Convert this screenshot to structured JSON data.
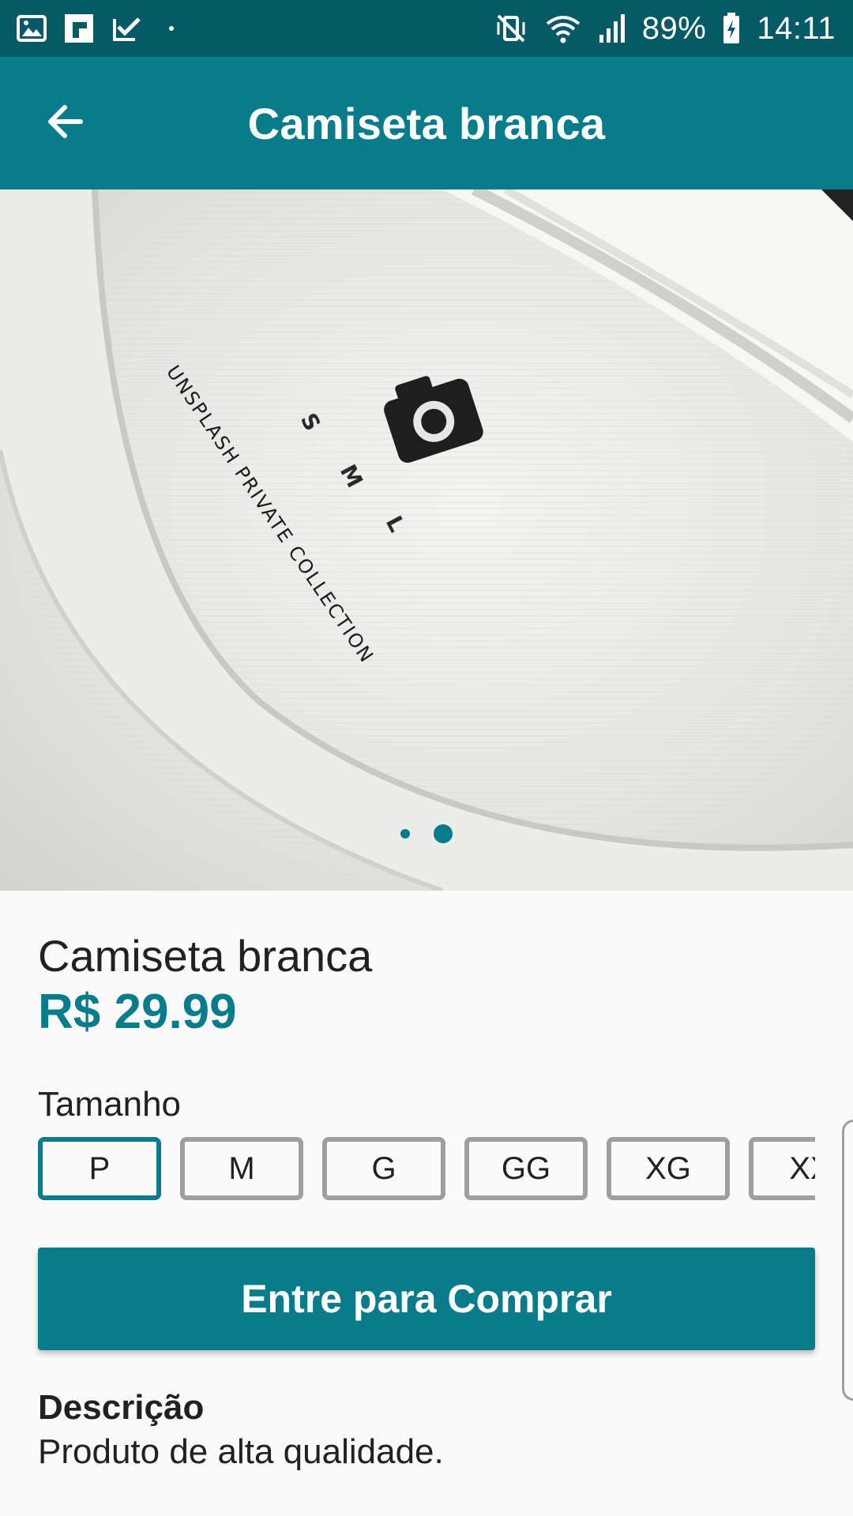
{
  "status_bar": {
    "battery": "89%",
    "time": "14:11",
    "left_icons": [
      "gallery-icon",
      "flipboard-icon",
      "task-check-icon"
    ],
    "right_icons": [
      "vibrate-mute-icon",
      "wifi-icon",
      "signal-icon",
      "battery-charging-icon"
    ]
  },
  "app_bar": {
    "title": "Camiseta branca",
    "back_icon": "arrow-left-icon"
  },
  "carousel": {
    "image_subject": "white t-shirt collar label",
    "label_text": "UNSPLASH PRIVATE COLLECTION",
    "size_letters": [
      "S",
      "M",
      "L"
    ],
    "page_count": 2,
    "active_page": 2
  },
  "product": {
    "name": "Camiseta branca",
    "price": "R$ 29.99"
  },
  "sizes": {
    "label": "Tamanho",
    "options": [
      "P",
      "M",
      "G",
      "GG",
      "XG",
      "XX"
    ],
    "selected": "P"
  },
  "buy_button": {
    "label": "Entre para Comprar"
  },
  "description": {
    "title": "Descrição",
    "text": "Produto de alta qualidade."
  },
  "colors": {
    "primary": "#087c8a",
    "status_bar": "#065a66",
    "chip_border": "#9e9e9e"
  }
}
